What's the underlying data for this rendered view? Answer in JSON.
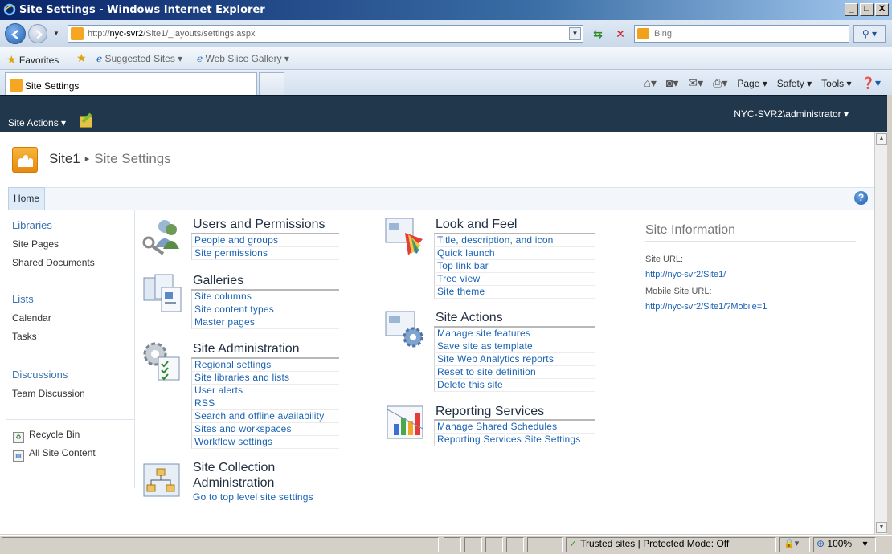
{
  "window": {
    "title": "Site Settings - Windows Internet Explorer",
    "minimize": "_",
    "maximize": "□",
    "close": "X"
  },
  "address": {
    "url_prefix": "http://",
    "url_host": "nyc-svr2",
    "url_path": "/Site1/_layouts/settings.aspx",
    "search_placeholder": "Bing"
  },
  "favorites_bar": {
    "favorites": "Favorites",
    "suggested_sites": "Suggested Sites ▾",
    "web_slice_gallery": "Web Slice Gallery ▾"
  },
  "tab": {
    "label": "Site Settings"
  },
  "command_bar": {
    "page": "Page ▾",
    "safety": "Safety ▾",
    "tools": "Tools ▾"
  },
  "sp_ribbon": {
    "site_actions": "Site Actions ▾",
    "user": "NYC-SVR2\\administrator ▾"
  },
  "breadcrumb": {
    "site": "Site1",
    "separator": "▸",
    "page": "Site Settings"
  },
  "top_nav": {
    "home": "Home"
  },
  "left_nav": {
    "libraries": "Libraries",
    "site_pages": "Site Pages",
    "shared_documents": "Shared Documents",
    "lists": "Lists",
    "calendar": "Calendar",
    "tasks": "Tasks",
    "discussions": "Discussions",
    "team_discussion": "Team Discussion",
    "recycle_bin": "Recycle Bin",
    "all_site_content": "All Site Content"
  },
  "sections": {
    "users_permissions": {
      "title": "Users and Permissions",
      "links": [
        "People and groups",
        "Site permissions"
      ]
    },
    "galleries": {
      "title": "Galleries",
      "links": [
        "Site columns",
        "Site content types",
        "Master pages"
      ]
    },
    "site_administration": {
      "title": "Site Administration",
      "links": [
        "Regional settings",
        "Site libraries and lists",
        "User alerts",
        "RSS",
        "Search and offline availability",
        "Sites and workspaces",
        "Workflow settings"
      ]
    },
    "site_collection_administration": {
      "title_line1": "Site Collection",
      "title_line2": "Administration",
      "link": "Go to top level site settings"
    },
    "look_and_feel": {
      "title": "Look and Feel",
      "links": [
        "Title, description, and icon",
        "Quick launch",
        "Top link bar",
        "Tree view",
        "Site theme"
      ]
    },
    "site_actions": {
      "title": "Site Actions",
      "links": [
        "Manage site features",
        "Save site as template",
        "Site Web Analytics reports",
        "Reset to site definition",
        "Delete this site"
      ]
    },
    "reporting_services": {
      "title": "Reporting Services",
      "links": [
        "Manage Shared Schedules",
        "Reporting Services Site Settings"
      ]
    }
  },
  "site_information": {
    "title": "Site Information",
    "site_url_label": "Site URL:",
    "site_url": "http://nyc-svr2/Site1/",
    "mobile_url_label": "Mobile Site URL:",
    "mobile_url": "http://nyc-svr2/Site1/?Mobile=1"
  },
  "status_bar": {
    "zone": "Trusted sites | Protected Mode: Off",
    "zoom": "100%"
  }
}
